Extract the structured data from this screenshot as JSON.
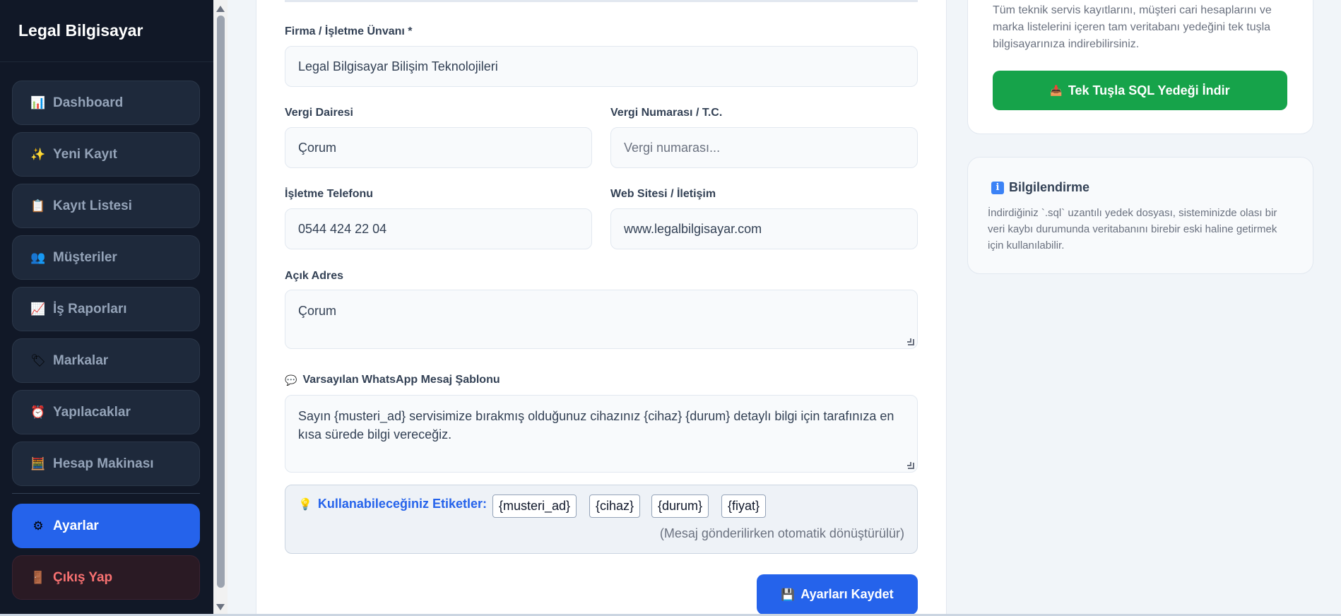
{
  "app": {
    "title": "Legal Bilgisayar"
  },
  "sidebar": {
    "items": [
      {
        "icon": "📊",
        "icon_name": "chart-icon",
        "label": "Dashboard"
      },
      {
        "icon": "✨",
        "icon_name": "sparkles-icon",
        "label": "Yeni Kayıt"
      },
      {
        "icon": "📋",
        "icon_name": "clipboard-icon",
        "label": "Kayıt Listesi"
      },
      {
        "icon": "👥",
        "icon_name": "users-icon",
        "label": "Müşteriler"
      },
      {
        "icon": "📈",
        "icon_name": "trend-icon",
        "label": "İş Raporları"
      },
      {
        "icon": "🏷",
        "icon_name": "tag-icon",
        "label": "Markalar"
      },
      {
        "icon": "⏰",
        "icon_name": "alarm-icon",
        "label": "Yapılacaklar"
      },
      {
        "icon": "🧮",
        "icon_name": "abacus-icon",
        "label": "Hesap Makinası"
      }
    ],
    "settings": {
      "icon": "⚙",
      "icon_name": "gear-icon",
      "label": "Ayarlar"
    },
    "logout": {
      "icon": "🚪",
      "icon_name": "door-icon",
      "label": "Çıkış Yap"
    }
  },
  "form": {
    "company_label": "Firma / İşletme Ünvanı *",
    "company_value": "Legal Bilgisayar Bilişim Teknolojileri",
    "tax_office_label": "Vergi Dairesi",
    "tax_office_value": "Çorum",
    "tax_no_label": "Vergi Numarası / T.C.",
    "tax_no_placeholder": "Vergi numarası...",
    "phone_label": "İşletme Telefonu",
    "phone_value": "0544 424 22 04",
    "web_label": "Web Sitesi / İletişim",
    "web_value": "www.legalbilgisayar.com",
    "address_label": "Açık Adres",
    "address_value": "Çorum",
    "whatsapp_icon": "💬",
    "whatsapp_label": "Varsayılan WhatsApp Mesaj Şablonu",
    "whatsapp_value": "Sayın {musteri_ad} servisimize bırakmış olduğunuz cihazınız {cihaz} {durum} detaylı bilgi için tarafınıza en kısa sürede bilgi vereceğiz.",
    "tags_icon": "💡",
    "tags_title": "Kullanabileceğiniz Etiketler:",
    "tags": [
      "{musteri_ad}",
      "{cihaz}",
      "{durum}",
      "{fiyat}"
    ],
    "tags_note": "(Mesaj gönderilirken otomatik dönüştürülür)",
    "save_icon": "💾",
    "save_label": "Ayarları Kaydet"
  },
  "backup": {
    "description": "Tüm teknik servis kayıtlarını, müşteri cari hesaplarını ve marka listelerini içeren tam veritabanı yedeğini tek tuşla bilgisayarınıza indirebilirsiniz.",
    "button_icon": "📥",
    "button_label": "Tek Tuşla SQL Yedeği İndir"
  },
  "info": {
    "icon": "i",
    "title": "Bilgilendirme",
    "text": "İndirdiğiniz `.sql` uzantılı yedek dosyası, sisteminizde olası bir veri kaybı durumunda veritabanını birebir eski haline getirmek için kullanılabilir."
  }
}
